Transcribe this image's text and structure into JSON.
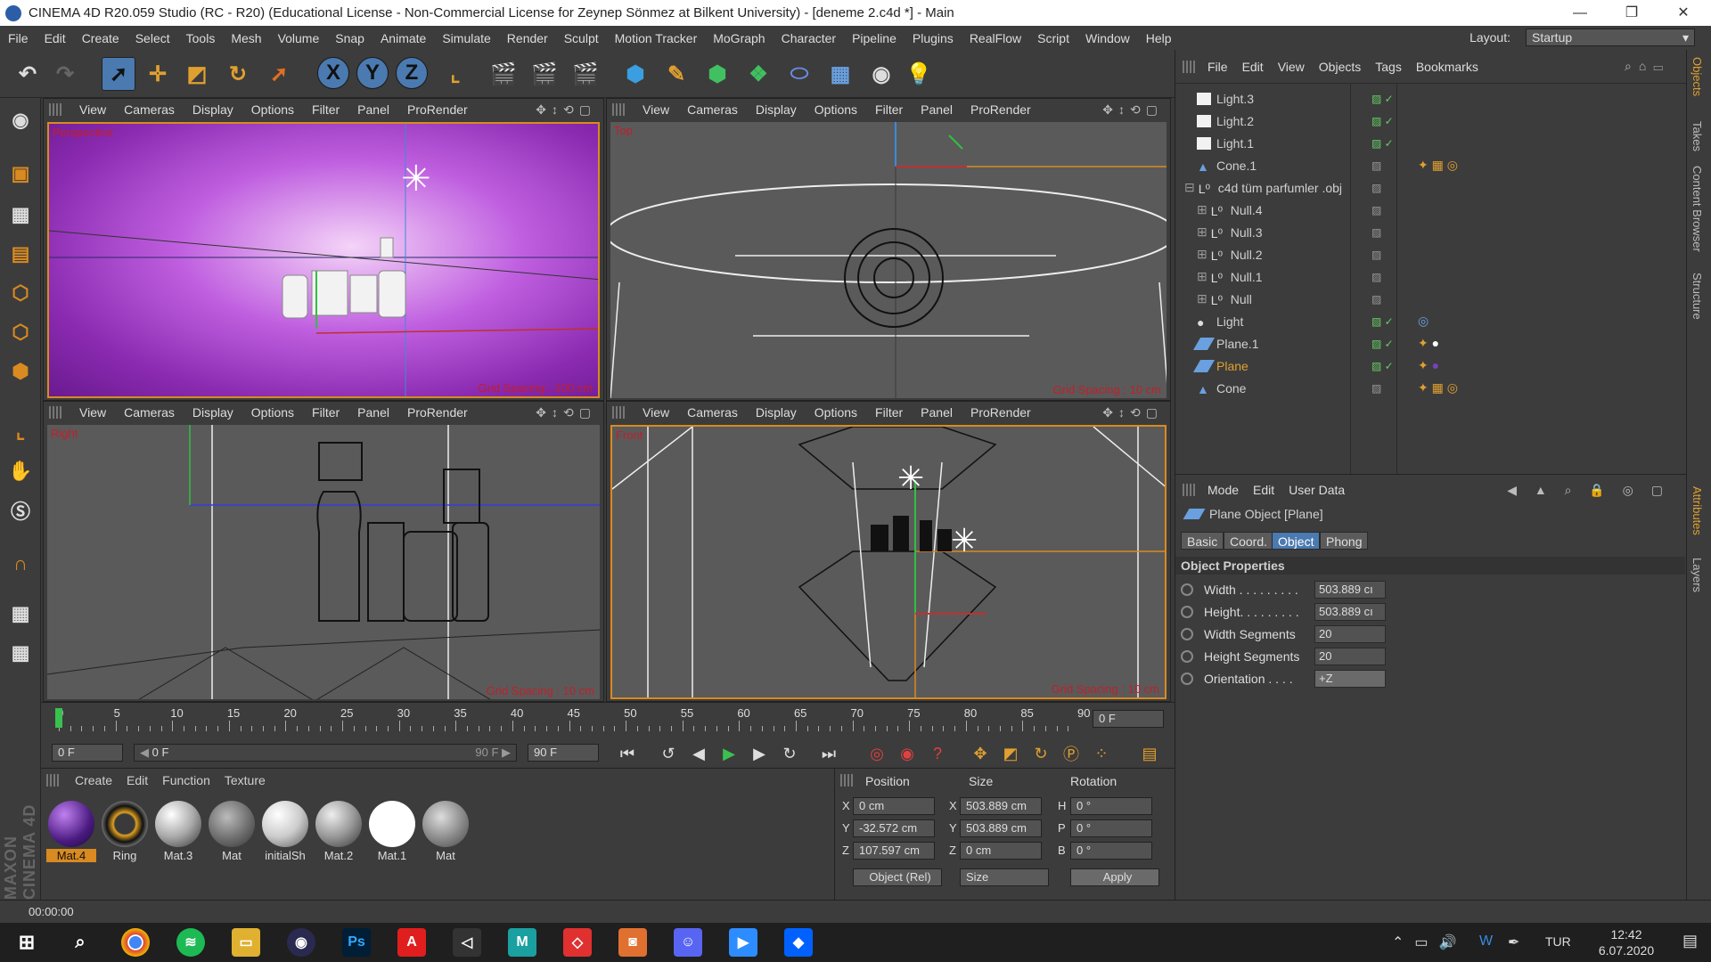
{
  "title": "CINEMA 4D R20.059 Studio (RC - R20) (Educational License - Non-Commercial License for Zeynep  Sönmez at Bilkent University) - [deneme 2.c4d *] - Main",
  "menu": [
    "File",
    "Edit",
    "Create",
    "Select",
    "Tools",
    "Mesh",
    "Volume",
    "Snap",
    "Animate",
    "Simulate",
    "Render",
    "Sculpt",
    "Motion Tracker",
    "MoGraph",
    "Character",
    "Pipeline",
    "Plugins",
    "RealFlow",
    "Script",
    "Window",
    "Help"
  ],
  "layout_label": "Layout:",
  "layout_value": "Startup",
  "viewport_menu": [
    "View",
    "Cameras",
    "Display",
    "Options",
    "Filter",
    "Panel",
    "ProRender"
  ],
  "viewports": {
    "perspective": {
      "label": "Perspective",
      "grid": "Grid Spacing : 100 cm"
    },
    "top": {
      "label": "Top",
      "grid": "Grid Spacing : 10 cm"
    },
    "right": {
      "label": "Right",
      "grid": "Grid Spacing : 10 cm"
    },
    "front": {
      "label": "Front",
      "grid": "Grid Spacing : 10 cm"
    }
  },
  "objects_menu": [
    "File",
    "Edit",
    "View",
    "Objects",
    "Tags",
    "Bookmarks"
  ],
  "objects": [
    {
      "name": "Light.3",
      "type": "light-icon",
      "check": true
    },
    {
      "name": "Light.2",
      "type": "light-icon",
      "check": true
    },
    {
      "name": "Light.1",
      "type": "light-icon",
      "check": true
    },
    {
      "name": "Cone.1",
      "type": "cone-icon",
      "check": false
    },
    {
      "name": "c4d tüm parfumler .obj",
      "type": "null-icon",
      "check": false
    },
    {
      "name": "Null.4",
      "type": "null-icon",
      "check": false
    },
    {
      "name": "Null.3",
      "type": "null-icon",
      "check": false
    },
    {
      "name": "Null.2",
      "type": "null-icon",
      "check": false
    },
    {
      "name": "Null.1",
      "type": "null-icon",
      "check": false
    },
    {
      "name": "Null",
      "type": "null-icon",
      "check": false
    },
    {
      "name": "Light",
      "type": "light-icon",
      "check": true
    },
    {
      "name": "Plane.1",
      "type": "plane-icon",
      "check": true
    },
    {
      "name": "Plane",
      "type": "plane-icon",
      "check": true
    },
    {
      "name": "Cone",
      "type": "cone-icon",
      "check": false
    }
  ],
  "attributes": {
    "menu": [
      "Mode",
      "Edit",
      "User Data"
    ],
    "object_title": "Plane Object [Plane]",
    "tabs": [
      "Basic",
      "Coord.",
      "Object",
      "Phong"
    ],
    "selected_tab": "Object",
    "section": "Object Properties",
    "props": [
      {
        "label": "Width . . . . . . . . .",
        "value": "503.889 cı"
      },
      {
        "label": "Height. . . . . . . . .",
        "value": "503.889 cı"
      },
      {
        "label": "Width Segments",
        "value": "20"
      },
      {
        "label": "Height Segments",
        "value": "20"
      },
      {
        "label": "Orientation . . . .",
        "value": "+Z"
      }
    ]
  },
  "side_tabs": [
    "Objects",
    "Takes",
    "Content Browser",
    "Structure",
    "Attributes",
    "Layers"
  ],
  "timeline": {
    "ticks": [
      "0",
      "5",
      "10",
      "15",
      "20",
      "25",
      "30",
      "35",
      "40",
      "45",
      "50",
      "55",
      "60",
      "65",
      "70",
      "75",
      "80",
      "85",
      "90"
    ],
    "current": "0 F",
    "start": "0 F",
    "range_start": "0 F",
    "range_end": "90 F",
    "end": "90 F"
  },
  "materials_menu": [
    "Create",
    "Edit",
    "Function",
    "Texture"
  ],
  "materials": [
    "Mat.4",
    "Ring",
    "Mat.3",
    "Mat",
    "initialSh",
    "Mat.2",
    "Mat.1",
    "Mat"
  ],
  "coords": {
    "headers": [
      "Position",
      "Size",
      "Rotation"
    ],
    "rows": [
      {
        "axis": "X",
        "pos": "0 cm",
        "saxis": "X",
        "size": "503.889 cm",
        "raxis": "H",
        "rot": "0 °"
      },
      {
        "axis": "Y",
        "pos": "-32.572 cm",
        "saxis": "Y",
        "size": "503.889 cm",
        "raxis": "P",
        "rot": "0 °"
      },
      {
        "axis": "Z",
        "pos": "107.597 cm",
        "saxis": "Z",
        "size": "0 cm",
        "raxis": "B",
        "rot": "0 °"
      }
    ],
    "mode": "Object (Rel)",
    "size_mode": "Size",
    "apply": "Apply"
  },
  "status": "00:00:00",
  "maxon_logo": "MAXON CINEMA 4D",
  "taskbar": {
    "lang": "TUR",
    "time": "12:42",
    "date": "6.07.2020"
  }
}
